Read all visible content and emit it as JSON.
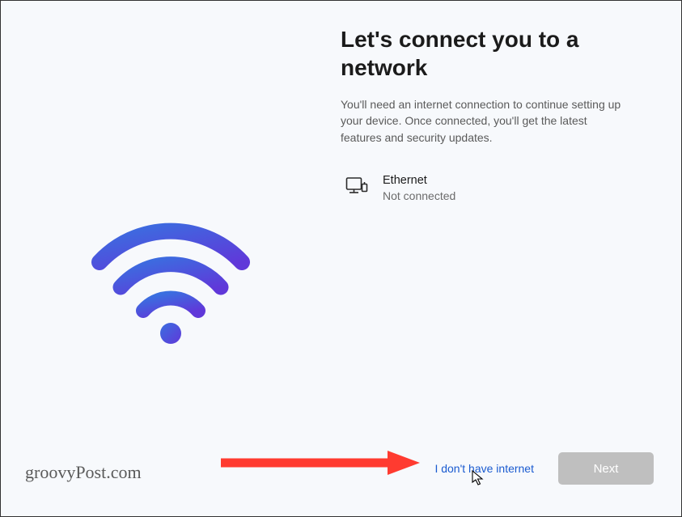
{
  "page": {
    "title": "Let's connect you to a network",
    "subtitle": "You'll need an internet connection to continue setting up your device. Once connected, you'll get the latest features and security updates."
  },
  "network": {
    "name": "Ethernet",
    "status": "Not connected"
  },
  "footer": {
    "skip_label": "I don't have internet",
    "next_label": "Next",
    "watermark": "groovyPost.com"
  },
  "colors": {
    "accent_start": "#3a6fe0",
    "accent_end": "#6038d9",
    "link": "#1a5bd0",
    "disabled_btn_bg": "#bfbfbf"
  }
}
